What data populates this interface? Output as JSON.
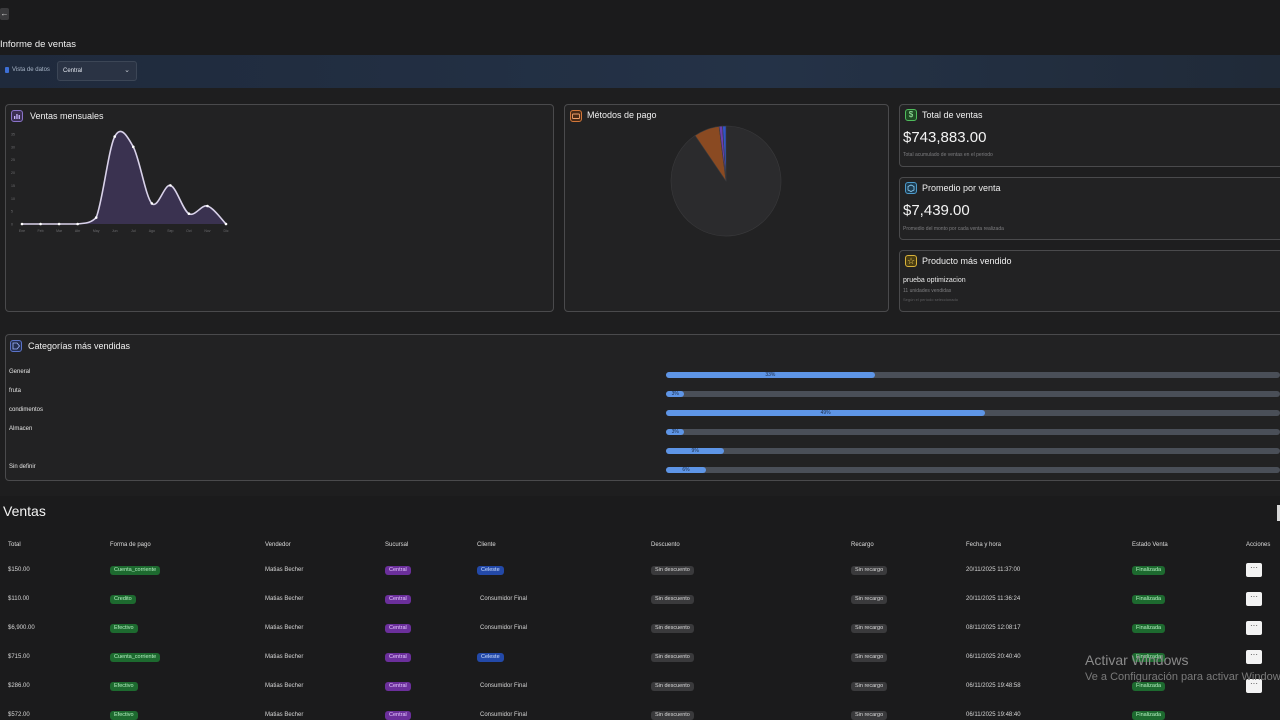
{
  "header": {
    "back_label": "←",
    "title": "Informe de ventas"
  },
  "filter": {
    "label": "Vista de datos",
    "selected": "Central"
  },
  "colors": {
    "accent": "#5e95e6",
    "area_fill": "#3a3250",
    "area_line": "#d9d2ea"
  },
  "monthly": {
    "title": "Ventas mensuales",
    "icon": "bar-chart-icon",
    "chart_data": {
      "type": "area",
      "categories": [
        "Ene",
        "Feb",
        "Mar",
        "Abr",
        "May",
        "Jun",
        "Jul",
        "Ago",
        "Sep",
        "Oct",
        "Nov",
        "Dic"
      ],
      "values": [
        0,
        0,
        0,
        0,
        2.5,
        34,
        30,
        8,
        15,
        4,
        7,
        0
      ],
      "ylim": [
        0,
        35
      ],
      "yticks": [
        "0",
        "5",
        "10",
        "15",
        "20",
        "25",
        "30",
        "35"
      ],
      "grid": false
    }
  },
  "payments": {
    "title": "Métodos de pago",
    "icon": "wallet-icon",
    "chart_data": {
      "type": "pie",
      "slices": [
        {
          "value": 90.5,
          "color": "#2b2b2d"
        },
        {
          "value": 7.5,
          "color": "#8a4a22"
        },
        {
          "value": 1,
          "color": "#6b3fb0"
        },
        {
          "value": 1,
          "color": "#2f55c8"
        }
      ]
    }
  },
  "total": {
    "title": "Total de ventas",
    "icon": "dollar-icon",
    "value": "$743,883.00",
    "sub": "Total acumulado de ventas en el periodo"
  },
  "average": {
    "title": "Promedio por venta",
    "icon": "box-icon",
    "value": "$7,439.00",
    "sub": "Promedio del monto por cada venta realizada"
  },
  "top_product": {
    "title": "Producto más vendido",
    "icon": "star-icon",
    "name": "prueba optimizacion",
    "units": "11 unidades vendidas",
    "note": "Según el período seleccionado"
  },
  "categories": {
    "title": "Categorías más vendidas",
    "icon": "tag-icon",
    "items": [
      {
        "label": "General",
        "pct_text": "33%",
        "value": 34
      },
      {
        "label": "fruta",
        "pct_text": "3%",
        "value": 3
      },
      {
        "label": "condimentos",
        "pct_text": "49%",
        "value": 52
      },
      {
        "label": "Almacen",
        "pct_text": "3%",
        "value": 3
      },
      {
        "label": "",
        "pct_text": "9%",
        "value": 9.5
      },
      {
        "label": "Sin definir",
        "pct_text": "6%",
        "value": 6.5
      }
    ]
  },
  "sales": {
    "title": "Ventas",
    "headers": [
      "Total",
      "Forma de pago",
      "Vendedor",
      "Sucursal",
      "Cliente",
      "Descuento",
      "Recargo",
      "Fecha y hora",
      "Estado Venta",
      "Acciones"
    ],
    "rows": [
      {
        "total": "$150.00",
        "pago": "Cuenta_corriente",
        "pago_style": "green",
        "vendedor": "Matias Becher",
        "sucursal": "Central",
        "cliente": "Celeste",
        "cliente_pill": true,
        "descuento": "Sin descuento",
        "recargo": "Sin recargo",
        "fecha": "20/11/2025 11:37:00",
        "estado": "Finalizada"
      },
      {
        "total": "$110.00",
        "pago": "Credito",
        "pago_style": "green",
        "vendedor": "Matias Becher",
        "sucursal": "Central",
        "cliente": "Consumidor Final",
        "cliente_pill": false,
        "descuento": "Sin descuento",
        "recargo": "Sin recargo",
        "fecha": "20/11/2025 11:36:24",
        "estado": "Finalizada"
      },
      {
        "total": "$6,900.00",
        "pago": "Efectivo",
        "pago_style": "green",
        "vendedor": "Matias Becher",
        "sucursal": "Central",
        "cliente": "Consumidor Final",
        "cliente_pill": false,
        "descuento": "Sin descuento",
        "recargo": "Sin recargo",
        "fecha": "08/11/2025 12:08:17",
        "estado": "Finalizada"
      },
      {
        "total": "$715.00",
        "pago": "Cuenta_corriente",
        "pago_style": "green",
        "vendedor": "Matias Becher",
        "sucursal": "Central",
        "cliente": "Celeste",
        "cliente_pill": true,
        "descuento": "Sin descuento",
        "recargo": "Sin recargo",
        "fecha": "06/11/2025 20:40:40",
        "estado": "Finalizada"
      },
      {
        "total": "$286.00",
        "pago": "Efectivo",
        "pago_style": "green",
        "vendedor": "Matias Becher",
        "sucursal": "Central",
        "cliente": "Consumidor Final",
        "cliente_pill": false,
        "descuento": "Sin descuento",
        "recargo": "Sin recargo",
        "fecha": "06/11/2025 19:48:58",
        "estado": "Finalizada"
      },
      {
        "total": "$572.00",
        "pago": "Efectivo",
        "pago_style": "green",
        "vendedor": "Matias Becher",
        "sucursal": "Central",
        "cliente": "Consumidor Final",
        "cliente_pill": false,
        "descuento": "Sin descuento",
        "recargo": "Sin recargo",
        "fecha": "06/11/2025 19:48:40",
        "estado": "Finalizada"
      }
    ],
    "action_label": "···"
  },
  "watermark": {
    "line1": "Activar Windows",
    "line2": "Ve a Configuración para activar Windows."
  }
}
